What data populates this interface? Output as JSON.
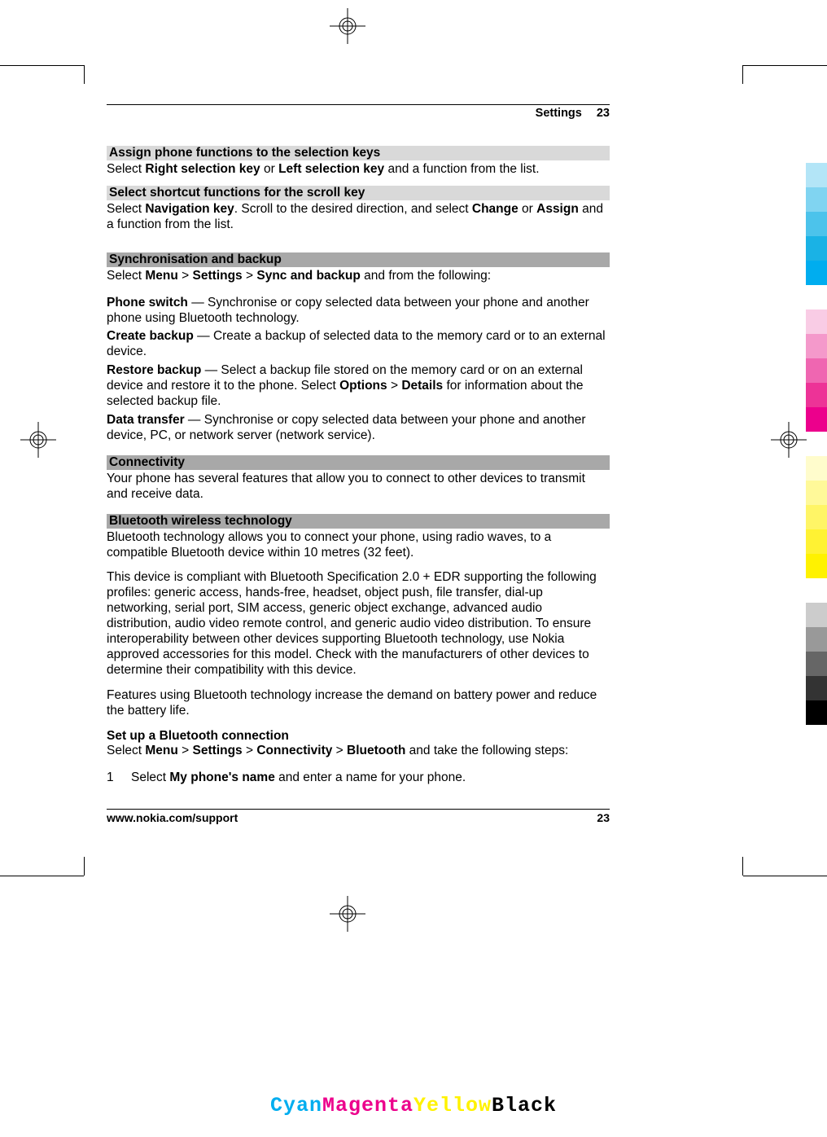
{
  "header": {
    "section": "Settings",
    "page": "23"
  },
  "h1": "Assign phone functions to the selection keys",
  "p1a": "Select ",
  "p1b": "Right selection key",
  "p1c": " or ",
  "p1d": "Left selection key",
  "p1e": " and a function from the list.",
  "h2": "Select shortcut functions for the scroll key",
  "p2a": "Select ",
  "p2b": "Navigation key",
  "p2c": ". Scroll to the desired direction, and select ",
  "p2d": "Change",
  "p2e": " or ",
  "p2f": "Assign",
  "p2g": " and a function from the list.",
  "h3": "Synchronisation and backup",
  "p3a": "Select ",
  "p3b": "Menu",
  "p3c": " > ",
  "p3d": "Settings",
  "p3e": " > ",
  "p3f": "Sync and backup",
  "p3g": " and from the following:",
  "i1a": "Phone switch",
  "i1b": "  — Synchronise or copy selected data between your phone and another phone using Bluetooth technology.",
  "i2a": "Create backup",
  "i2b": "  — Create a backup of selected data to the memory card or to an external device.",
  "i3a": "Restore backup",
  "i3b": "  — Select a backup file stored on the memory card or on an external device and restore it to the phone. Select ",
  "i3c": "Options",
  "i3d": " > ",
  "i3e": "Details",
  "i3f": " for information about the selected backup file.",
  "i4a": "Data transfer",
  "i4b": "  — Synchronise or copy selected data between your phone and another device, PC, or network server (network service).",
  "h4": "Connectivity",
  "p4": "Your phone has several features that allow you to connect to other devices to transmit and receive data.",
  "h5": "Bluetooth wireless technology",
  "p5": "Bluetooth technology allows you to connect your phone, using radio waves, to a compatible Bluetooth device within 10 metres (32 feet).",
  "p6": "This device is compliant with Bluetooth Specification 2.0 + EDR supporting the following profiles: generic access, hands-free, headset, object push, file transfer, dial-up networking, serial port, SIM access, generic object exchange, advanced audio distribution, audio video remote control, and generic audio video distribution. To ensure interoperability between other devices supporting Bluetooth technology, use Nokia approved accessories for this model. Check with the manufacturers of other devices to determine their compatibility with this device.",
  "p7": "Features using Bluetooth technology increase the demand on battery power and reduce the battery life.",
  "h6": "Set up a Bluetooth connection",
  "p8a": "Select ",
  "p8b": "Menu",
  "p8c": " > ",
  "p8d": "Settings",
  "p8e": " > ",
  "p8f": "Connectivity",
  "p8g": " > ",
  "p8h": "Bluetooth",
  "p8i": " and take the following steps:",
  "ol1n": "1",
  "ol1a": "Select ",
  "ol1b": "My phone's name",
  "ol1c": " and enter a name for your phone.",
  "footer": {
    "url": "www.nokia.com/support",
    "page": "23"
  },
  "cmyk": {
    "c": "Cyan",
    "m": "Magenta",
    "y": "Yellow",
    "k": "Black"
  },
  "bars": [
    "#b3e5f7",
    "#80d4f1",
    "#4cc3eb",
    "#1ab2e5",
    "#00adef",
    "#f9cce5",
    "#f499cb",
    "#ef66b1",
    "#ed3397",
    "#ec008c",
    "#fffccc",
    "#fff999",
    "#fff566",
    "#fff233",
    "#fff200",
    "#cccccc",
    "#999999",
    "#666666",
    "#333333",
    "#000000"
  ]
}
